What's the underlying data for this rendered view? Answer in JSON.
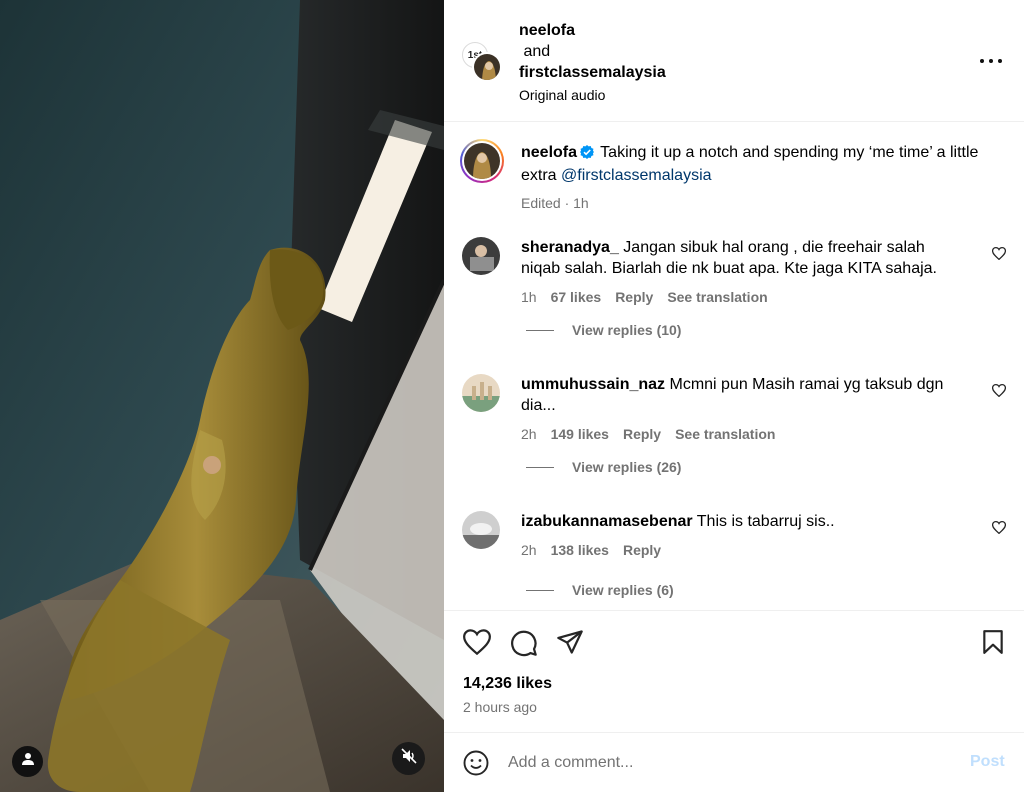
{
  "header": {
    "user1": "neelofa",
    "conjunction": "and",
    "user2": "firstclassemalaysia",
    "audio": "Original audio",
    "collab_logo_text": "1st"
  },
  "caption": {
    "username": "neelofa",
    "text": "Taking it up a notch and spending my ‘me time’ a little extra",
    "mention": "@firstclassemalaysia",
    "meta": "Edited · 1h"
  },
  "comments": [
    {
      "username": "sheranadya_",
      "text": "Jangan sibuk hal orang , die freehair salah niqab salah. Biarlah die nk buat apa. Kte jaga KITA sahaja.",
      "time": "1h",
      "likes": "67 likes",
      "reply": "Reply",
      "translate": "See translation",
      "view_replies": "View replies (10)"
    },
    {
      "username": "ummuhussain_naz",
      "text": "Mcmni pun Masih ramai yg taksub dgn dia...",
      "time": "2h",
      "likes": "149 likes",
      "reply": "Reply",
      "translate": "See translation",
      "view_replies": "View replies (26)"
    },
    {
      "username": "izabukannamasebenar",
      "text": "This is tabarruj sis..",
      "time": "2h",
      "likes": "138 likes",
      "reply": "Reply",
      "view_replies": "View replies (6)"
    }
  ],
  "actions": {
    "likes": "14,236 likes",
    "time_ago": "2 hours ago"
  },
  "composer": {
    "placeholder": "Add a comment...",
    "post_label": "Post"
  },
  "icons": {
    "more": "more-horizontal-icon",
    "verified": "verified-badge-icon",
    "like": "heart-icon",
    "comment": "comment-bubble-icon",
    "share": "paper-plane-icon",
    "save": "bookmark-icon",
    "emoji": "smiley-icon",
    "user_tag": "person-icon",
    "mute": "speaker-muted-icon"
  },
  "colors": {
    "link": "#00376b",
    "muted_text": "#737373",
    "verified_blue": "#0095f6",
    "post_disabled": "#c0dffd"
  }
}
